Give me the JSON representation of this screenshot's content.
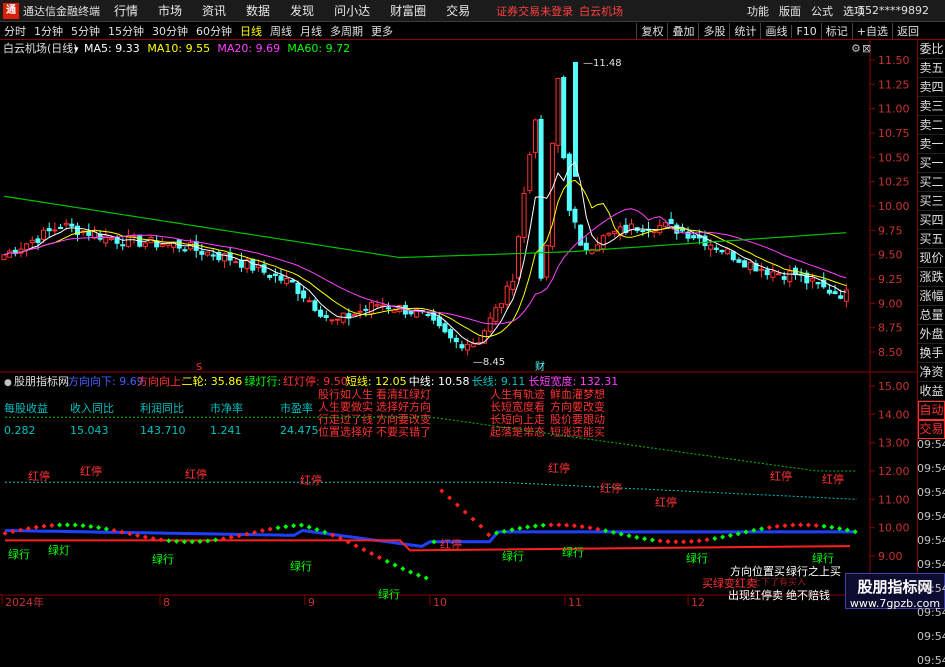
{
  "app": {
    "title": "通达信金融终端"
  },
  "menu": [
    "行情",
    "市场",
    "资讯",
    "数据",
    "发现",
    "问小达",
    "财富圈",
    "交易"
  ],
  "notice": "证券交易未登录",
  "notice_stock": "白云机场",
  "right_menu": [
    "功能",
    "版面",
    "公式",
    "选项"
  ],
  "account": "152****9892",
  "timeframes": [
    {
      "label": "分时",
      "active": false
    },
    {
      "label": "1分钟",
      "active": false
    },
    {
      "label": "5分钟",
      "active": false
    },
    {
      "label": "15分钟",
      "active": false
    },
    {
      "label": "30分钟",
      "active": false
    },
    {
      "label": "60分钟",
      "active": false
    },
    {
      "label": "日线",
      "active": true
    },
    {
      "label": "周线",
      "active": false
    },
    {
      "label": "月线",
      "active": false
    },
    {
      "label": "多周期",
      "active": false
    },
    {
      "label": "更多",
      "active": false
    }
  ],
  "tools": [
    "复权",
    "叠加",
    "多股",
    "统计",
    "画线",
    "F10",
    "标记",
    "+自选",
    "返回"
  ],
  "chart": {
    "stock_label": "白云机场(日线)",
    "ma": [
      {
        "label": "MA5: 9.33",
        "color": "#ffffff"
      },
      {
        "label": "MA10: 9.55",
        "color": "#ffff00"
      },
      {
        "label": "MA20: 9.69",
        "color": "#ff40ff"
      },
      {
        "label": "MA60: 9.72",
        "color": "#00ff00"
      }
    ],
    "high_label": "11.48",
    "low_label": "8.45",
    "marker_s": "S",
    "marker_cai": "财",
    "price_axis": [
      "11.50",
      "11.25",
      "11.00",
      "10.75",
      "10.50",
      "10.25",
      "10.00",
      "9.75",
      "9.50",
      "9.25",
      "9.00",
      "8.75",
      "8.50"
    ],
    "lower_axis": [
      "15.00",
      "14.00",
      "13.00",
      "12.00",
      "11.00",
      "10.00",
      "9.00"
    ],
    "date_axis": [
      "2024年",
      "8",
      "9",
      "10",
      "11",
      "12"
    ]
  },
  "indicator": {
    "name": "股朋指标网",
    "params": [
      {
        "text": "方向向下: 9.69",
        "color": "#4060ff"
      },
      {
        "text": "方向向上: ",
        "color": "#ff3030"
      },
      {
        "text": "二轮: 35.86",
        "color": "#ffff00"
      },
      {
        "text": "绿灯行: ",
        "color": "#00ff00"
      },
      {
        "text": "红灯停: 9.50",
        "color": "#ff3030"
      },
      {
        "text": "短线: 12.05",
        "color": "#ffff00"
      },
      {
        "text": "中线: 10.58",
        "color": "#ffffff"
      },
      {
        "text": "长线: 9.11",
        "color": "#00c0c0"
      },
      {
        "text": "长短宽度: 132.31",
        "color": "#ff40ff"
      }
    ],
    "table_headers": [
      "每股收益",
      "收入同比",
      "利润同比",
      "市净率",
      "市盈率"
    ],
    "table_values": [
      "0.282",
      "15.043",
      "143.710",
      "1.241",
      "24.475"
    ],
    "slogans_col1": [
      "股行如人生",
      "人生要做实",
      "行走过了线",
      "位置选择好"
    ],
    "slogans_col2": [
      "看清红绿灯",
      "选择好方向",
      "方向要改变",
      "不要买错了"
    ],
    "slogans_col3": [
      "人生有轨迹",
      "长短宽度看",
      "长短向上走",
      "起落是常态"
    ],
    "slogans_col4": [
      "鲜血灌梦想",
      "方向要改变",
      "股价要跟动",
      "短涨还能买"
    ],
    "labels_red": [
      "红停",
      "红停",
      "红停",
      "红停",
      "红停",
      "红停",
      "红停",
      "红停",
      "红停",
      "红停"
    ],
    "labels_green": [
      "绿行",
      "绿灯",
      "绿行",
      "绿行",
      "绿行",
      "绿行",
      "绿行",
      "绿行",
      "绿行"
    ],
    "bottom_notes": [
      "方向位置买",
      "绿行之上买",
      "买绿变红卖",
      "出现红停卖",
      "绝不赔钱"
    ],
    "faint_note": "上下了有买入"
  },
  "side_panel": [
    "委比",
    "卖五",
    "卖四",
    "卖三",
    "卖二",
    "卖一",
    "买一",
    "买二",
    "买三",
    "买四",
    "买五",
    "现价",
    "涨跌",
    "涨幅",
    "总量",
    "外盘",
    "换手",
    "净资",
    "收益"
  ],
  "side_panel_lower": [
    "自动",
    "交易"
  ],
  "times": [
    "09:54",
    "09:54",
    "09:54",
    "09:54",
    "09:54",
    "09:54",
    "09:54",
    "09:54",
    "09:54",
    "09:54"
  ],
  "watermark": {
    "line1": "股朋指标网",
    "line2": "www.7gpzb.com"
  }
}
